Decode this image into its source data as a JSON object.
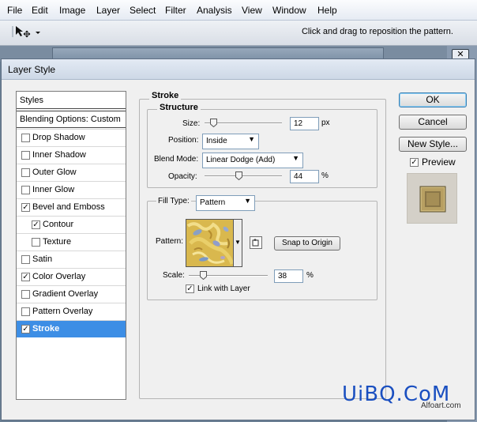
{
  "menubar": {
    "items": [
      "File",
      "Edit",
      "Image",
      "Layer",
      "Select",
      "Filter",
      "Analysis",
      "View",
      "Window",
      "Help"
    ]
  },
  "options_bar": {
    "tool_icon": "move-pattern-tool-icon",
    "hint": "Click and drag to reposition the pattern."
  },
  "dialog": {
    "title": "Layer Style",
    "styles_header": "Styles",
    "blending_header": "Blending Options: Custom",
    "items": [
      {
        "label": "Drop Shadow",
        "checked": false
      },
      {
        "label": "Inner Shadow",
        "checked": false
      },
      {
        "label": "Outer Glow",
        "checked": false
      },
      {
        "label": "Inner Glow",
        "checked": false
      },
      {
        "label": "Bevel and Emboss",
        "checked": true
      },
      {
        "label": "Contour",
        "checked": true,
        "sub": true
      },
      {
        "label": "Texture",
        "checked": false,
        "sub": true
      },
      {
        "label": "Satin",
        "checked": false
      },
      {
        "label": "Color Overlay",
        "checked": true
      },
      {
        "label": "Gradient Overlay",
        "checked": false
      },
      {
        "label": "Pattern Overlay",
        "checked": false
      },
      {
        "label": "Stroke",
        "checked": true,
        "selected": true
      }
    ],
    "stroke": {
      "title": "Stroke",
      "structure_title": "Structure",
      "size_label": "Size:",
      "size_value": "12",
      "size_unit": "px",
      "position_label": "Position:",
      "position_value": "Inside",
      "blend_mode_label": "Blend Mode:",
      "blend_mode_value": "Linear Dodge (Add)",
      "opacity_label": "Opacity:",
      "opacity_value": "44",
      "opacity_unit": "%",
      "fill_type_label": "Fill Type:",
      "fill_type_value": "Pattern",
      "pattern_label": "Pattern:",
      "snap_button": "Snap to Origin",
      "scale_label": "Scale:",
      "scale_value": "38",
      "scale_unit": "%",
      "link_label": "Link with Layer",
      "link_checked": true
    },
    "buttons": {
      "ok": "OK",
      "cancel": "Cancel",
      "new_style": "New Style...",
      "preview_label": "Preview",
      "preview_checked": true
    }
  },
  "watermark": {
    "text": "UiBQ.CoM",
    "small": "Alfoart.com"
  },
  "colors": {
    "selection": "#3d8ee5",
    "preview_gold": "#b9a46a",
    "watermark_blue": "#1a4fc0"
  }
}
